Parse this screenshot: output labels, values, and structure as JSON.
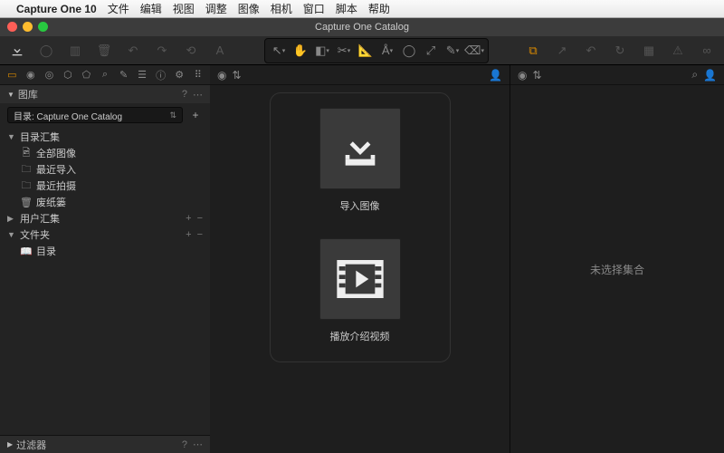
{
  "menubar": {
    "app": "Capture One 10",
    "items": [
      "文件",
      "编辑",
      "视图",
      "调整",
      "图像",
      "相机",
      "窗口",
      "脚本",
      "帮助"
    ]
  },
  "window": {
    "title": "Capture One Catalog"
  },
  "sidebar": {
    "library_header": "图库",
    "catalog_label": "目录: Capture One Catalog",
    "sections": {
      "catalog_group": "目录汇集",
      "catalog_children": [
        "全部图像",
        "最近导入",
        "最近拍摄",
        "废纸篓"
      ],
      "user_group": "用户汇集",
      "folders_group": "文件夹",
      "folders_children": [
        "目录"
      ]
    },
    "filter_header": "过滤器"
  },
  "viewer": {
    "import_label": "导入图像",
    "video_label": "播放介绍视频"
  },
  "browser": {
    "empty_text": "未选择集合"
  }
}
